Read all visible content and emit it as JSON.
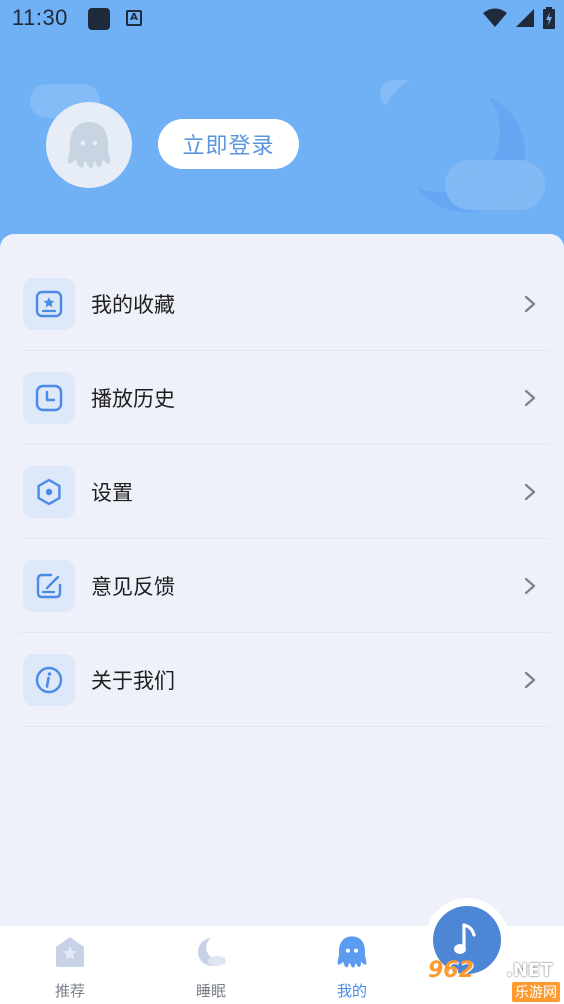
{
  "status_bar": {
    "time": "11:30",
    "icons": [
      "square-notification-icon",
      "a-notification-icon",
      "wifi-icon",
      "signal-icon",
      "battery-charging-icon"
    ]
  },
  "header": {
    "login_label": "立即登录",
    "avatar_icon": "octopus-avatar-icon"
  },
  "menu": {
    "items": [
      {
        "label": "我的收藏",
        "icon": "favorites-icon"
      },
      {
        "label": "播放历史",
        "icon": "history-clock-icon"
      },
      {
        "label": "设置",
        "icon": "settings-hex-icon"
      },
      {
        "label": "意见反馈",
        "icon": "feedback-edit-icon"
      },
      {
        "label": "关于我们",
        "icon": "info-icon"
      }
    ]
  },
  "tabbar": {
    "tabs": [
      {
        "label": "推荐",
        "icon": "recommend-star-icon",
        "active": false
      },
      {
        "label": "睡眠",
        "icon": "sleep-moon-icon",
        "active": false
      },
      {
        "label": "我的",
        "icon": "octopus-profile-icon",
        "active": true
      }
    ],
    "player_icon": "music-note-icon"
  },
  "watermark": {
    "brand": "962",
    "net": ".NET",
    "sub": "乐游网"
  },
  "colors": {
    "header_bg": "#70b0f5",
    "accent": "#4a8ae8",
    "panel_bg": "#eef1fa"
  }
}
